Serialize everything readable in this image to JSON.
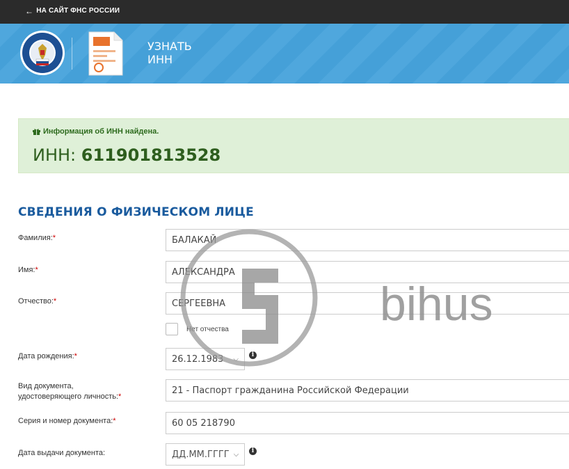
{
  "topbar": {
    "back_link": "НА САЙТ ФНС РОССИИ"
  },
  "header": {
    "app_title": "УЗНАТЬ ИНН"
  },
  "alert": {
    "heading": "Информация об ИНН найдена.",
    "inn_prefix": "ИНН:",
    "inn_value": "611901813528"
  },
  "section": {
    "title": "СВЕДЕНИЯ О ФИЗИЧЕСКОМ ЛИЦЕ"
  },
  "form": {
    "surname": {
      "label": "Фамилия:",
      "value": "БАЛАКАЙ"
    },
    "name": {
      "label": "Имя:",
      "value": "АЛЕКСАНДРА"
    },
    "patronymic": {
      "label": "Отчество:",
      "value": "СЕРГЕЕВНА",
      "no_patronymic_label": "Нет отчества"
    },
    "birth_date": {
      "label": "Дата рождения:",
      "value": "26.12.1983"
    },
    "doc_type": {
      "label_line1": "Вид документа,",
      "label_line2": "удостоверяющего личность:",
      "value": "21 - Паспорт гражданина Российской Федерации"
    },
    "doc_number": {
      "label": "Серия и номер документа:",
      "value": "60 05 218790"
    },
    "doc_date": {
      "label": "Дата выдачи документа:",
      "value": "ДД.ММ.ГГГГ"
    }
  },
  "watermark": {
    "brand": "bihus"
  }
}
